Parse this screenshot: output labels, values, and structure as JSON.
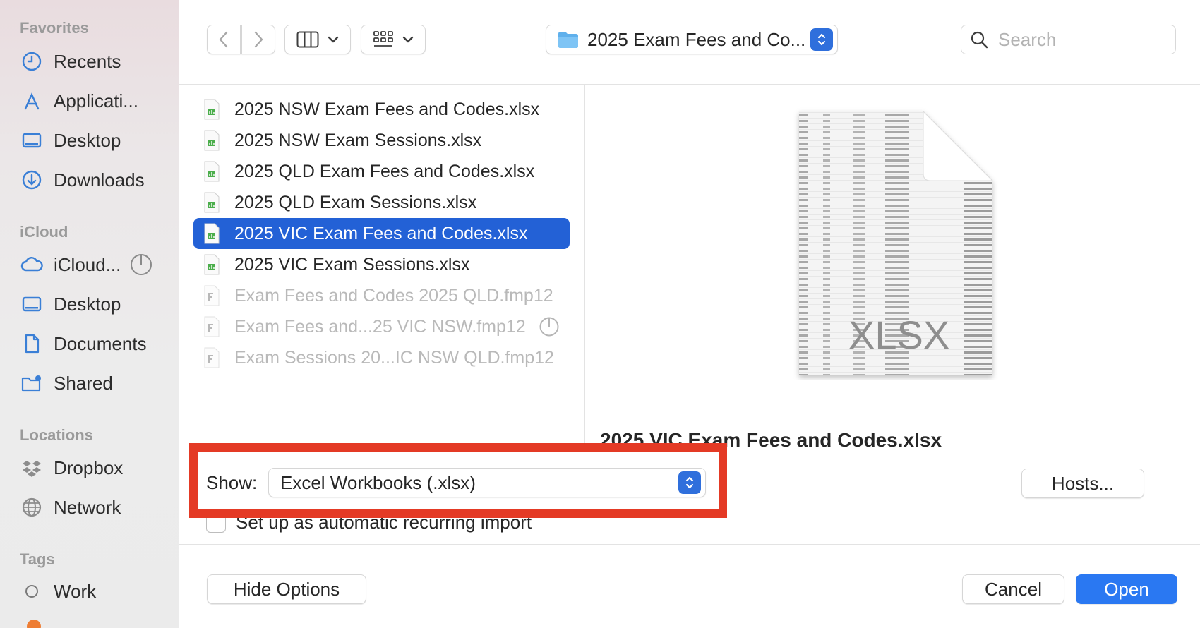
{
  "sidebar": {
    "sections": [
      {
        "heading": "Favorites"
      },
      {
        "heading": "iCloud"
      },
      {
        "heading": "Locations"
      },
      {
        "heading": "Tags"
      }
    ],
    "favorites": [
      {
        "label": "Recents",
        "icon": "clock-icon"
      },
      {
        "label": "Applicati...",
        "icon": "applications-icon"
      },
      {
        "label": "Desktop",
        "icon": "desktop-icon"
      },
      {
        "label": "Downloads",
        "icon": "download-icon"
      }
    ],
    "icloud": [
      {
        "label": "iCloud...",
        "icon": "cloud-icon"
      },
      {
        "label": "Desktop",
        "icon": "desktop-icon"
      },
      {
        "label": "Documents",
        "icon": "document-icon"
      },
      {
        "label": "Shared",
        "icon": "shared-folder-icon"
      }
    ],
    "locations": [
      {
        "label": "Dropbox",
        "icon": "dropbox-icon"
      },
      {
        "label": "Network",
        "icon": "globe-icon"
      }
    ],
    "tags": [
      {
        "label": "Work",
        "icon": "tag-circle-icon"
      }
    ]
  },
  "toolbar": {
    "path_label": "2025 Exam Fees and Co...",
    "search_placeholder": "Search"
  },
  "files": [
    {
      "name": "2025 NSW Exam Fees and Codes.xlsx",
      "type": "xlsx",
      "selected": false,
      "enabled": true
    },
    {
      "name": "2025 NSW Exam Sessions.xlsx",
      "type": "xlsx",
      "selected": false,
      "enabled": true
    },
    {
      "name": "2025 QLD Exam Fees and Codes.xlsx",
      "type": "xlsx",
      "selected": false,
      "enabled": true
    },
    {
      "name": "2025 QLD Exam Sessions.xlsx",
      "type": "xlsx",
      "selected": false,
      "enabled": true
    },
    {
      "name": "2025 VIC Exam Fees and Codes.xlsx",
      "type": "xlsx",
      "selected": true,
      "enabled": true
    },
    {
      "name": "2025 VIC Exam Sessions.xlsx",
      "type": "xlsx",
      "selected": false,
      "enabled": true
    },
    {
      "name": "Exam Fees and Codes 2025 QLD.fmp12",
      "type": "fmp12",
      "selected": false,
      "enabled": false
    },
    {
      "name": "Exam Fees and...25 VIC NSW.fmp12",
      "type": "fmp12",
      "selected": false,
      "enabled": false
    },
    {
      "name": "Exam Sessions 20...IC NSW QLD.fmp12",
      "type": "fmp12",
      "selected": false,
      "enabled": false
    }
  ],
  "preview": {
    "doc_label": "XLSX",
    "filename": "2025 VIC Exam Fees and Codes.xlsx"
  },
  "options": {
    "show_label": "Show:",
    "show_value": "Excel Workbooks (.xlsx)",
    "checkbox_label": "Set up as automatic recurring import",
    "hosts_label": "Hosts..."
  },
  "buttons": {
    "hide_options": "Hide Options",
    "cancel": "Cancel",
    "open": "Open"
  },
  "colors": {
    "accent": "#2361d6",
    "primary_button": "#2a78f2",
    "highlight_box": "#e43a25",
    "spreadsheet_green": "#4cae4c"
  }
}
